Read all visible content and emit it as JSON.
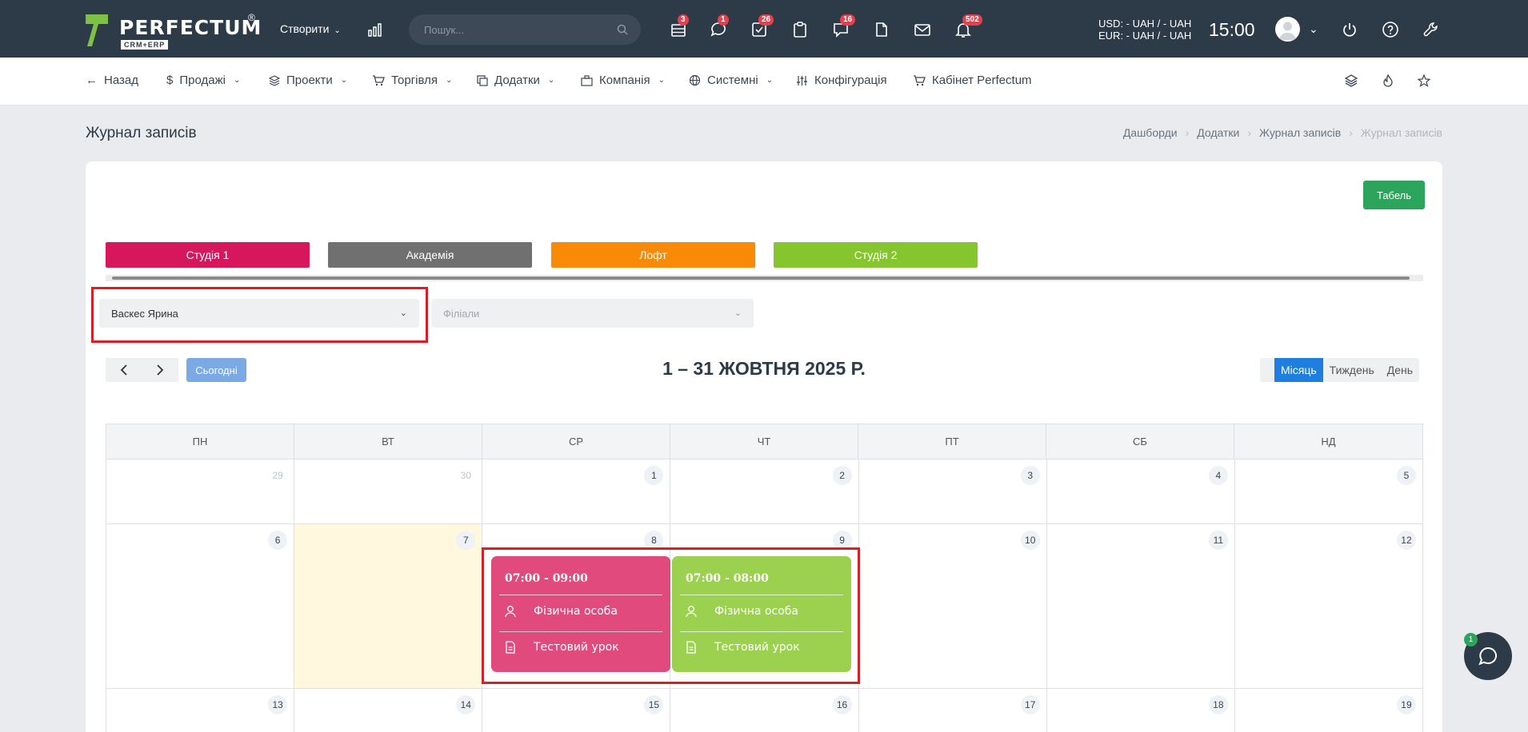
{
  "topbar": {
    "logo_text": "PERFECTUM",
    "logo_sub": "CRM+ERP",
    "logo_reg": "®",
    "create_label": "Створити",
    "search_placeholder": "Пошук...",
    "badges": {
      "tables": "3",
      "chat": "1",
      "tasks": "26",
      "comments": "16",
      "alerts": "502"
    },
    "currency_usd": "USD: - UAH / - UAH",
    "currency_eur": "EUR: - UAH / - UAH",
    "time": "15:00"
  },
  "menu": {
    "back": "Назад",
    "sales": "Продажі",
    "projects": "Проекти",
    "trade": "Торгівля",
    "addons": "Додатки",
    "company": "Компанія",
    "system": "Системні",
    "config": "Конфігурація",
    "cabinet": "Кабінет Perfectum"
  },
  "page": {
    "title": "Журнал записів",
    "breadcrumbs": [
      "Дашборди",
      "Додатки",
      "Журнал записів",
      "Журнал записів"
    ]
  },
  "toolbar": {
    "tabel_label": "Табель"
  },
  "branches": [
    {
      "label": "Студія 1",
      "color": "#d6175c"
    },
    {
      "label": "Академія",
      "color": "#707070"
    },
    {
      "label": "Лофт",
      "color": "#f98a08"
    },
    {
      "label": "Студія 2",
      "color": "#85c52d"
    }
  ],
  "filters": {
    "employee_value": "Васкес Ярина",
    "branches_placeholder": "Філіали"
  },
  "calendar": {
    "today_label": "Сьогодні",
    "title": "1 – 31 ЖОВТНЯ 2025 Р.",
    "views": [
      "Місяць",
      "Тиждень",
      "День"
    ],
    "active_view": "Місяць",
    "weekdays": [
      "ПН",
      "ВТ",
      "СР",
      "ЧТ",
      "ПТ",
      "СБ",
      "НД"
    ],
    "weeks": [
      [
        "29",
        "30",
        "1",
        "2",
        "3",
        "4",
        "5"
      ],
      [
        "6",
        "7",
        "8",
        "9",
        "10",
        "11",
        "12"
      ],
      [
        "13",
        "14",
        "15",
        "16",
        "17",
        "18",
        "19"
      ]
    ],
    "events": [
      {
        "time": "07:00 - 09:00",
        "client": "Фізична особа",
        "lesson": "Тестовий урок",
        "color": "#e04a7d"
      },
      {
        "time": "07:00 - 08:00",
        "client": "Фізична особа",
        "lesson": "Тестовий урок",
        "color": "#9bd14f"
      }
    ]
  },
  "chat": {
    "badge": "1"
  }
}
